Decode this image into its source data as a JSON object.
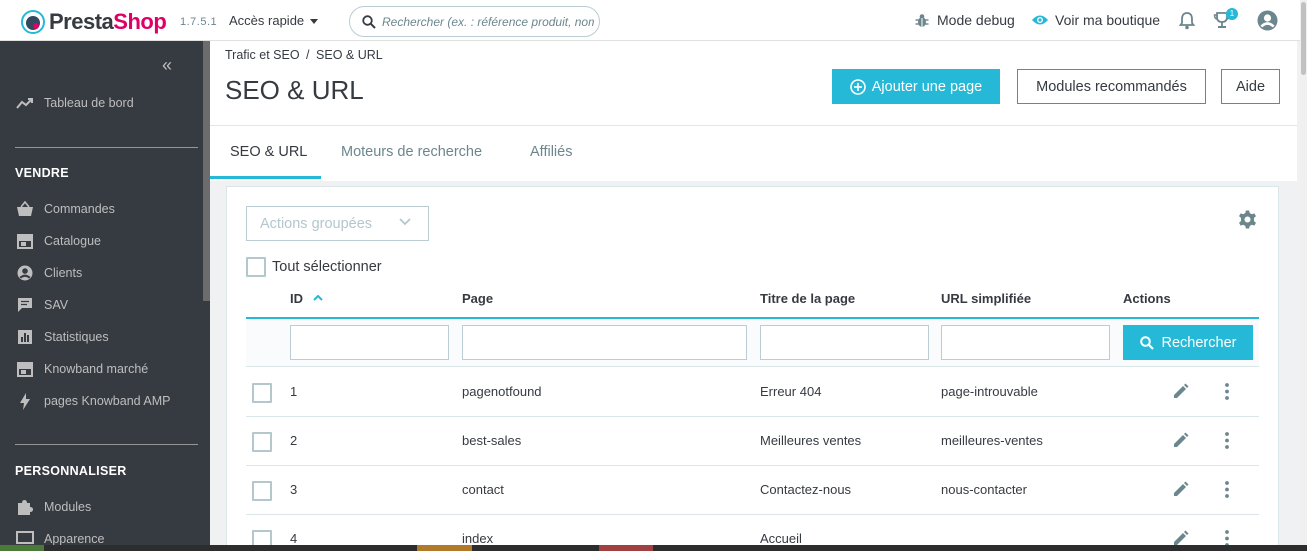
{
  "topbar": {
    "logo_main": "Presta",
    "logo_accent": "Shop",
    "version": "1.7.5.1",
    "quick_access": "Accès rapide",
    "search_placeholder": "Rechercher (ex. : référence produit, nom",
    "debug_label": "Mode debug",
    "view_shop_label": "Voir ma boutique",
    "notification_count": "1"
  },
  "sidebar": {
    "dashboard": "Tableau de bord",
    "sections": [
      {
        "title": "VENDRE",
        "items": [
          "Commandes",
          "Catalogue",
          "Clients",
          "SAV",
          "Statistiques",
          "Knowband marché",
          "pages Knowband AMP"
        ]
      },
      {
        "title": "PERSONNALISER",
        "items": [
          "Modules",
          "Apparence"
        ]
      }
    ]
  },
  "header": {
    "breadcrumb": [
      "Trafic et SEO",
      "SEO & URL"
    ],
    "breadcrumb_separator": "/",
    "title": "SEO & URL",
    "buttons": {
      "add_page": "Ajouter une page",
      "recommended_modules": "Modules recommandés",
      "help": "Aide"
    },
    "tabs": [
      "SEO & URL",
      "Moteurs de recherche",
      "Affiliés"
    ]
  },
  "table": {
    "bulk_actions": "Actions groupées",
    "select_all": "Tout sélectionner",
    "columns": [
      "ID",
      "Page",
      "Titre de la page",
      "URL simplifiée",
      "Actions"
    ],
    "search_button": "Rechercher",
    "rows": [
      {
        "id": "1",
        "page": "pagenotfound",
        "title": "Erreur 404",
        "url": "page-introuvable"
      },
      {
        "id": "2",
        "page": "best-sales",
        "title": "Meilleures ventes",
        "url": "meilleures-ventes"
      },
      {
        "id": "3",
        "page": "contact",
        "title": "Contactez-nous",
        "url": "nous-contacter"
      },
      {
        "id": "4",
        "page": "index",
        "title": "Accueil",
        "url": ""
      }
    ]
  },
  "colors": {
    "accent": "#25b9d7",
    "brand_pink": "#df0067",
    "sidebar_bg": "#363a41",
    "text": "#363a41",
    "muted": "#6c868e"
  },
  "icons": {
    "logo": "prestashop-logo-icon",
    "search": "search-icon",
    "debug": "bug-icon",
    "view_shop": "eye-icon",
    "notifications": "bell-icon",
    "trophy": "trophy-icon",
    "account": "user-circle-icon",
    "collapse": "double-chevron-left-icon",
    "add": "plus-circle-icon",
    "settings": "gear-icon",
    "edit": "pencil-icon",
    "more": "vertical-dots-icon"
  }
}
